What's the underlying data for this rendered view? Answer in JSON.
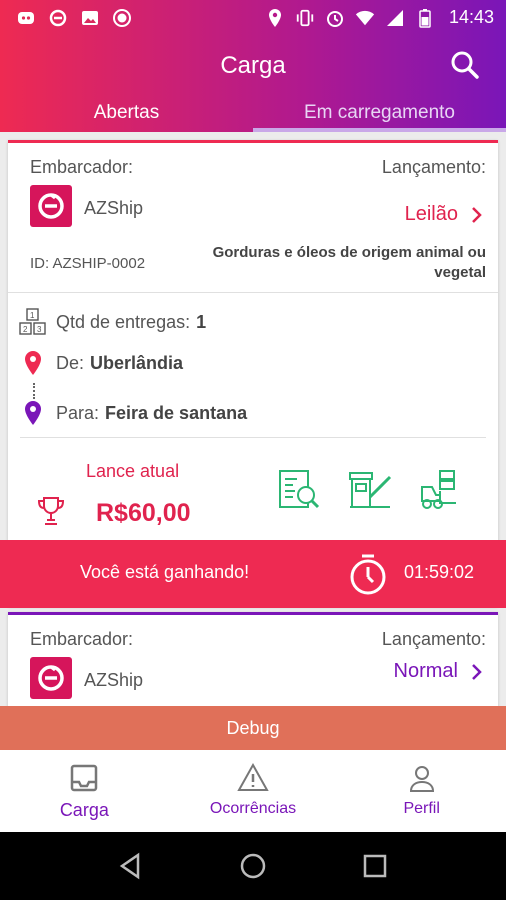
{
  "status_bar": {
    "time": "14:43"
  },
  "appbar": {
    "title": "Carga"
  },
  "tabs": [
    {
      "label": "Abertas"
    },
    {
      "label": "Em carregamento"
    }
  ],
  "cards": [
    {
      "shipper_label": "Embarcador:",
      "company": "AZShip",
      "launch_label": "Lançamento:",
      "launch_type": "Leilão",
      "id_text": "ID: AZSHIP-0002",
      "product": "Gorduras e óleos de origem animal ou vegetal",
      "deliveries_label": "Qtd de entregas:",
      "deliveries_value": "1",
      "from_label": "De:",
      "from_value": "Uberlândia",
      "to_label": "Para:",
      "to_value": "Feira de santana",
      "bid_label": "Lance atual",
      "bid_value": "R$60,00",
      "winning_msg": "Você está ganhando!",
      "timer": "01:59:02"
    },
    {
      "shipper_label": "Embarcador:",
      "company": "AZShip",
      "launch_label": "Lançamento:",
      "launch_type": "Normal"
    }
  ],
  "debug": {
    "label": "Debug"
  },
  "bottom_nav": [
    {
      "label": "Carga"
    },
    {
      "label": "Ocorrências"
    },
    {
      "label": "Perfil"
    }
  ],
  "colors": {
    "primary_red": "#ee2a52",
    "primary_purple": "#7a16b8",
    "green": "#2bb673",
    "debug": "#e07059"
  }
}
